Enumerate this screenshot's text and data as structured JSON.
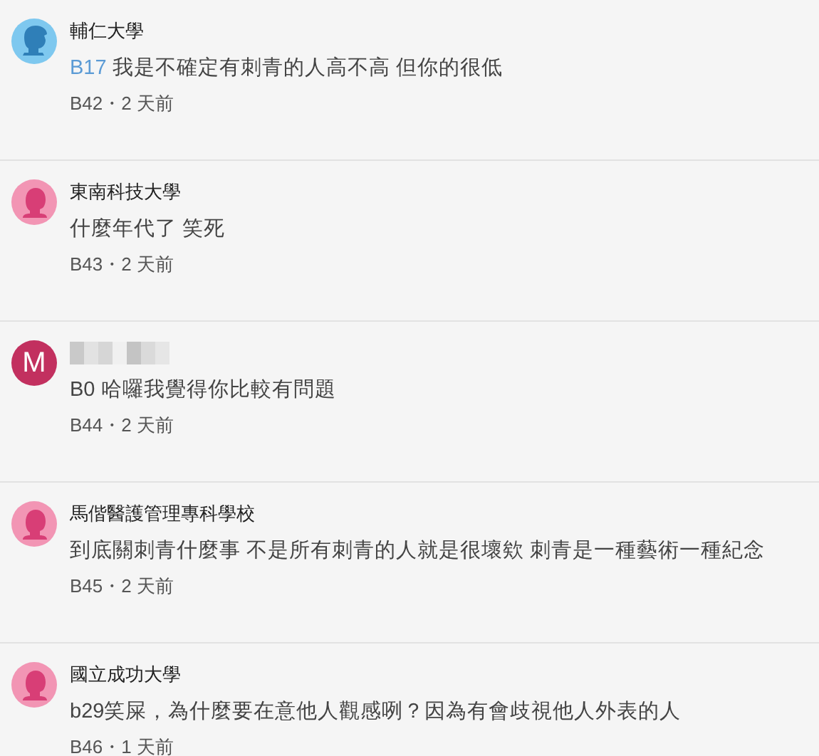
{
  "comments": [
    {
      "avatar": {
        "kind": "male"
      },
      "author": "輔仁大學",
      "reply_to": "B17",
      "text": "我是不確定有刺青的人高不高 但你的很低",
      "meta": "B42・2 天前"
    },
    {
      "avatar": {
        "kind": "female"
      },
      "author": "東南科技大學",
      "text": "什麼年代了 笑死",
      "meta": "B43・2 天前"
    },
    {
      "avatar": {
        "kind": "letter",
        "letter": "M"
      },
      "author_hidden": true,
      "text": "B0 哈囉我覺得你比較有問題",
      "meta": "B44・2 天前"
    },
    {
      "avatar": {
        "kind": "female"
      },
      "author": "馬偕醫護管理專科學校",
      "text": "到底關刺青什麼事 不是所有刺青的人就是很壞欸  刺青是一種藝術一種紀念",
      "meta": "B45・2 天前"
    },
    {
      "avatar": {
        "kind": "female"
      },
      "author": "國立成功大學",
      "text": "b29笑屎，為什麼要在意他人觀感咧？因為有會歧視他人外表的人",
      "meta": "B46・1 天前"
    }
  ]
}
